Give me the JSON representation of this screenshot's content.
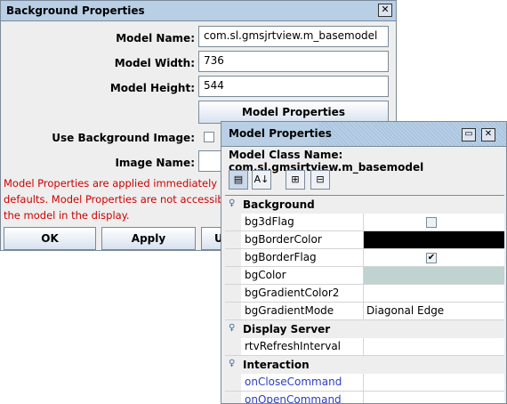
{
  "bg_window": {
    "title": "Background Properties",
    "close_glyph": "✕",
    "model_name_label": "Model Name:",
    "model_name_value": "com.sl.gmsjrtview.m_basemodel",
    "model_width_label": "Model Width:",
    "model_width_value": "736",
    "model_height_label": "Model Height:",
    "model_height_value": "544",
    "model_properties_button": "Model Properties",
    "use_bg_image_label": "Use Background Image:",
    "image_name_label": "Image Name:",
    "note_line1": "Model Properties are applied immediately an",
    "note_line2": "defaults. Model Properties are not accessible",
    "note_line3": "the model in the display.",
    "ok_button": "OK",
    "apply_button": "Apply",
    "third_button_partial": "U"
  },
  "mp_window": {
    "title": "Model Properties",
    "restore_glyph": "▭",
    "close_glyph": "✕",
    "class_name": "Model Class Name: com.sl.gmsjrtview.m_basemodel",
    "toolbar": [
      {
        "icon": "categorized-view-icon",
        "glyph": "▤"
      },
      {
        "icon": "sort-alphabetical-icon",
        "glyph": "A↓"
      },
      {
        "icon": "expand-all-icon",
        "glyph": "⊞"
      },
      {
        "icon": "collapse-all-icon",
        "glyph": "⊟"
      }
    ],
    "categories": {
      "background": "Background",
      "display_server": "Display Server",
      "interaction": "Interaction"
    },
    "properties": {
      "bg3dFlag": {
        "name": "bg3dFlag",
        "checked": false
      },
      "bgBorderColor": {
        "name": "bgBorderColor",
        "color": "#000000"
      },
      "bgBorderFlag": {
        "name": "bgBorderFlag",
        "checked": true
      },
      "bgColor": {
        "name": "bgColor",
        "color": "#bfd3d0"
      },
      "bgGradientColor2": {
        "name": "bgGradientColor2",
        "value": ""
      },
      "bgGradientMode": {
        "name": "bgGradientMode",
        "value": "Diagonal Edge"
      },
      "rtvRefreshInterval": {
        "name": "rtvRefreshInterval",
        "value": ""
      },
      "onCloseCommand": {
        "name": "onCloseCommand",
        "value": ""
      },
      "onOpenCommand": {
        "name": "onOpenCommand",
        "value": ""
      }
    },
    "check_glyph": "✔"
  }
}
